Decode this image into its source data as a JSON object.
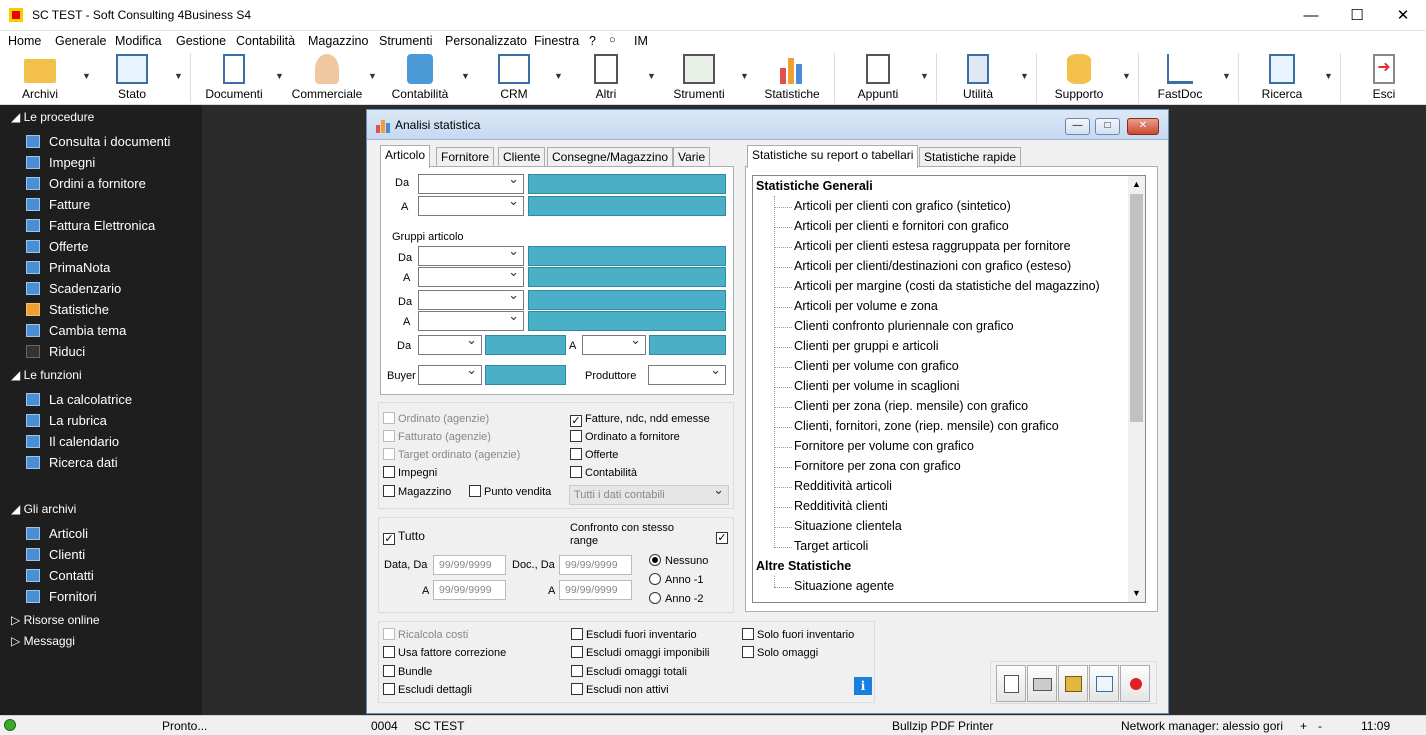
{
  "window": {
    "title": "SC TEST - Soft Consulting 4Business S4"
  },
  "menu": [
    "Home",
    "Generale",
    "Modifica",
    "Gestione",
    "Contabilità",
    "Magazzino",
    "Strumenti",
    "Personalizzato",
    "Finestra",
    "?",
    "IM"
  ],
  "toolbar": [
    "Archivi",
    "Stato",
    "Documenti",
    "Commerciale",
    "Contabilità",
    "CRM",
    "Altri",
    "Strumenti",
    "Statistiche",
    "Appunti",
    "Utilità",
    "Supporto",
    "FastDoc",
    "Ricerca",
    "Esci"
  ],
  "sidebar": {
    "procedure_header": "Le procedure",
    "procedure": [
      "Consulta i documenti",
      "Impegni",
      "Ordini a fornitore",
      "Fatture",
      "Fattura Elettronica",
      "Offerte",
      "PrimaNota",
      "Scadenzario",
      "Statistiche",
      "Cambia tema",
      "Riduci"
    ],
    "funzioni_header": "Le funzioni",
    "funzioni": [
      "La calcolatrice",
      "La rubrica",
      "Il calendario",
      "Ricerca dati"
    ],
    "archivi_header": "Gli archivi",
    "archivi": [
      "Articoli",
      "Clienti",
      "Contatti",
      "Fornitori"
    ],
    "risorse": "Risorse online",
    "messaggi": "Messaggi"
  },
  "dialog": {
    "title": "Analisi statistica",
    "left_tabs": [
      "Articolo",
      "Fornitore",
      "Cliente",
      "Consegne/Magazzino",
      "Varie"
    ],
    "lbl_da": "Da",
    "lbl_a": "A",
    "gruppi": "Gruppi articolo",
    "buyer": "Buyer",
    "produttore": "Produttore",
    "checks_left": [
      "Ordinato (agenzie)",
      "Fatturato (agenzie)",
      "Target ordinato (agenzie)",
      "Impegni",
      "Magazzino"
    ],
    "punto_vendita": "Punto vendita",
    "checks_right": [
      "Fatture, ndc, ndd emesse",
      "Ordinato a fornitore",
      "Offerte",
      "Contabilità"
    ],
    "contabili_combo": "Tutti i dati contabili",
    "tutto": "Tutto",
    "confronto": "Confronto con stesso range",
    "data_da": "Data, Da",
    "doc_da": "Doc., Da",
    "date_placeholder": "99/99/9999",
    "radio": [
      "Nessuno",
      "Anno -1",
      "Anno -2"
    ],
    "bottom_col1": [
      "Ricalcola costi",
      "Usa fattore correzione",
      "Bundle",
      "Escludi dettagli"
    ],
    "bottom_col2": [
      "Escludi fuori inventario",
      "Escludi omaggi imponibili",
      "Escludi omaggi totali",
      "Escludi non attivi"
    ],
    "bottom_col3": [
      "Solo fuori inventario",
      "Solo omaggi"
    ],
    "right_tabs": [
      "Statistiche su report o tabellari",
      "Statistiche rapide"
    ],
    "tree_h1": "Statistiche Generali",
    "tree_items1": [
      "Articoli per clienti con grafico (sintetico)",
      "Articoli per clienti e fornitori con grafico",
      "Articoli per clienti estesa raggruppata per fornitore",
      "Articoli per clienti/destinazioni con grafico (esteso)",
      "Articoli per margine (costi da statistiche del magazzino)",
      "Articoli per volume e zona",
      "Clienti confronto pluriennale con grafico",
      "Clienti per gruppi e articoli",
      "Clienti per volume con grafico",
      "Clienti per volume in scaglioni",
      "Clienti per zona (riep. mensile) con grafico",
      "Clienti, fornitori, zone (riep. mensile) con grafico",
      "Fornitore per volume con grafico",
      "Fornitore per zona con grafico",
      "Redditività articoli",
      "Redditività clienti",
      "Situazione clientela",
      "Target articoli"
    ],
    "tree_h2": "Altre Statistiche",
    "tree_items2": [
      "Situazione agente"
    ]
  },
  "status": {
    "text": "Pronto...",
    "code": "0004",
    "db": "SC TEST",
    "printer": "Bullzip PDF Printer",
    "network": "Network manager: alessio gori",
    "plus": "+",
    "minus": "-",
    "time": "11:09"
  }
}
